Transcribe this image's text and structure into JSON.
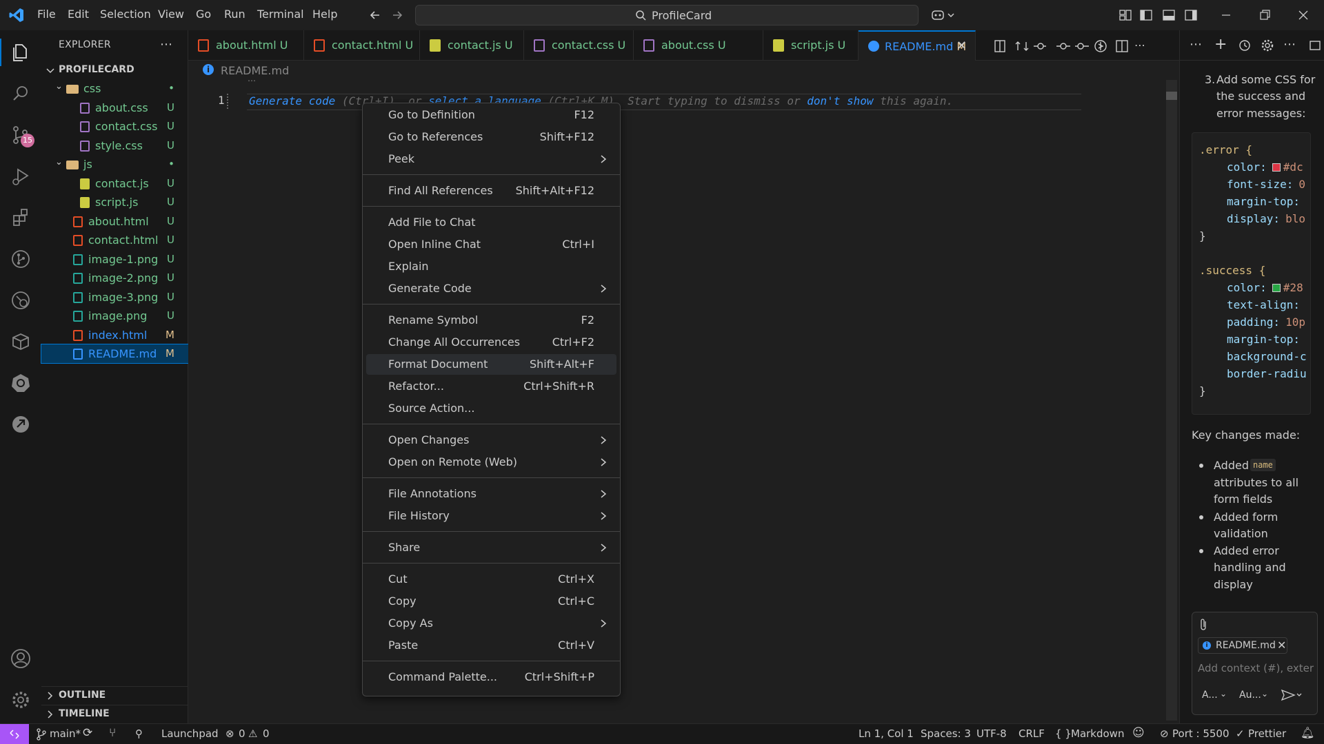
{
  "titlebar": {
    "menus": [
      "File",
      "Edit",
      "Selection",
      "View",
      "Go",
      "Run",
      "Terminal",
      "Help"
    ],
    "search": "ProfileCard"
  },
  "activity_bar": {
    "scm_badge": "15"
  },
  "explorer": {
    "title": "EXPLORER",
    "root": "PROFILECARD",
    "items": [
      {
        "label": "css",
        "status": "•",
        "type": "folder"
      },
      {
        "label": "about.css",
        "status": "U",
        "type": "css"
      },
      {
        "label": "contact.css",
        "status": "U",
        "type": "css"
      },
      {
        "label": "style.css",
        "status": "U",
        "type": "css"
      },
      {
        "label": "js",
        "status": "•",
        "type": "folder"
      },
      {
        "label": "contact.js",
        "status": "U",
        "type": "js"
      },
      {
        "label": "script.js",
        "status": "U",
        "type": "js"
      },
      {
        "label": "about.html",
        "status": "U",
        "type": "html"
      },
      {
        "label": "contact.html",
        "status": "U",
        "type": "html"
      },
      {
        "label": "image-1.png",
        "status": "U",
        "type": "png"
      },
      {
        "label": "image-2.png",
        "status": "U",
        "type": "png"
      },
      {
        "label": "image-3.png",
        "status": "U",
        "type": "png"
      },
      {
        "label": "image.png",
        "status": "U",
        "type": "png"
      },
      {
        "label": "index.html",
        "status": "M",
        "type": "html"
      },
      {
        "label": "README.md",
        "status": "M",
        "type": "md"
      }
    ],
    "outline": "OUTLINE",
    "timeline": "TIMELINE"
  },
  "tabs": [
    {
      "label": "about.html",
      "status": "U"
    },
    {
      "label": "contact.html",
      "status": "U"
    },
    {
      "label": "contact.js",
      "status": "U"
    },
    {
      "label": "contact.css",
      "status": "U"
    },
    {
      "label": "about.css",
      "status": "U"
    },
    {
      "label": "script.js",
      "status": "U"
    },
    {
      "label": "README.md",
      "status": "M"
    }
  ],
  "editor": {
    "breadcrumb": "README.md",
    "line_number": "1",
    "hint_generate": "Generate code",
    "hint_ctrl_i": "(Ctrl+I)",
    "hint_or": ", or",
    "hint_select_lang": "select a language",
    "hint_ctrl_k": "(Ctrl+K M).",
    "hint_start": "Start typing to dismiss or",
    "hint_dont_show": "don't show",
    "hint_end": "this again."
  },
  "context_menu": [
    {
      "label": "Go to Definition",
      "key": "F12"
    },
    {
      "label": "Go to References",
      "key": "Shift+F12"
    },
    {
      "label": "Peek",
      "key": "",
      "submenu": true
    },
    {
      "label": "Find All References",
      "key": "Shift+Alt+F12"
    },
    {
      "label": "Add File to Chat",
      "key": ""
    },
    {
      "label": "Open Inline Chat",
      "key": "Ctrl+I"
    },
    {
      "label": "Explain",
      "key": ""
    },
    {
      "label": "Generate Code",
      "key": "",
      "submenu": true
    },
    {
      "label": "Rename Symbol",
      "key": "F2"
    },
    {
      "label": "Change All Occurrences",
      "key": "Ctrl+F2"
    },
    {
      "label": "Format Document",
      "key": "Shift+Alt+F"
    },
    {
      "label": "Refactor...",
      "key": "Ctrl+Shift+R"
    },
    {
      "label": "Source Action...",
      "key": ""
    },
    {
      "label": "Open Changes",
      "key": "",
      "submenu": true
    },
    {
      "label": "Open on Remote (Web)",
      "key": "",
      "submenu": true
    },
    {
      "label": "File Annotations",
      "key": "",
      "submenu": true
    },
    {
      "label": "File History",
      "key": "",
      "submenu": true
    },
    {
      "label": "Share",
      "key": "",
      "submenu": true
    },
    {
      "label": "Cut",
      "key": "Ctrl+X"
    },
    {
      "label": "Copy",
      "key": "Ctrl+C"
    },
    {
      "label": "Copy As",
      "key": "",
      "submenu": true
    },
    {
      "label": "Paste",
      "key": "Ctrl+V"
    },
    {
      "label": "Command Palette...",
      "key": "Ctrl+Shift+P"
    }
  ],
  "chat": {
    "step_num": "3.",
    "step_text": [
      "Add some CSS for",
      "the success and",
      "error messages:"
    ],
    "code": {
      "error_sel": ".error {",
      "error_props": [
        {
          "prop": "color:",
          "val": "#dc",
          "swatch": "#dc3545"
        },
        {
          "prop": "font-size:",
          "val": "0"
        },
        {
          "prop": "margin-top:",
          "val": ""
        },
        {
          "prop": "display:",
          "val": "blo"
        }
      ],
      "close": "}",
      "success_sel": ".success {",
      "success_props": [
        {
          "prop": "color:",
          "val": "#28",
          "swatch": "#28a745"
        },
        {
          "prop": "text-align:",
          "val": ""
        },
        {
          "prop": "padding:",
          "val": "10p"
        },
        {
          "prop": "margin-top:",
          "val": ""
        },
        {
          "prop": "background-c",
          "val": ""
        },
        {
          "prop": "border-radiu",
          "val": ""
        }
      ]
    },
    "key_changes": "Key changes made:",
    "bullets": [
      [
        "Added",
        "name",
        "attributes to all",
        "form fields"
      ],
      [
        "Added form",
        "validation"
      ],
      [
        "Added error",
        "handling and",
        "display"
      ]
    ],
    "context_chip": "README.md",
    "input_placeholder": "Add context (#), exter",
    "mode_a": "A...",
    "mode_b": "Au..."
  },
  "statusbar": {
    "branch": "main*",
    "launchpad": "Launchpad",
    "errors": "0",
    "warnings": "0",
    "position": "Ln 1, Col 1",
    "spaces": "Spaces: 3",
    "encoding": "UTF-8",
    "eol": "CRLF",
    "language": "Markdown",
    "port": "Port : 5500",
    "prettier": "Prettier"
  }
}
